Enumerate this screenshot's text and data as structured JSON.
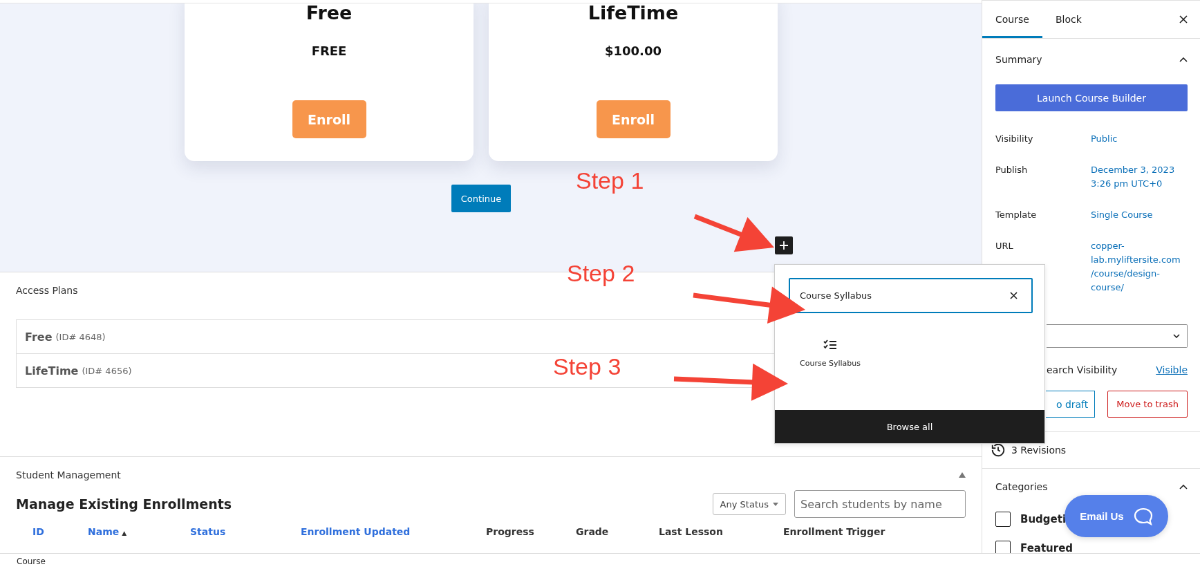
{
  "canvas": {
    "plans": [
      {
        "title": "Free",
        "price": "FREE",
        "button": "Enroll"
      },
      {
        "title": "LifeTime",
        "price": "$100.00",
        "button": "Enroll"
      }
    ],
    "continue_button": "Continue"
  },
  "annotations": [
    {
      "text": "Step 1"
    },
    {
      "text": "Step 2"
    },
    {
      "text": "Step 3"
    }
  ],
  "block_inserter": {
    "search_value": "Course Syllabus",
    "results": [
      {
        "label": "Course Syllabus"
      }
    ],
    "browse_all": "Browse all"
  },
  "access_plans": {
    "title": "Access Plans",
    "plans": [
      {
        "name": "Free",
        "id": "(ID# 4648)"
      },
      {
        "name": "LifeTime",
        "id": "(ID# 4656)"
      }
    ]
  },
  "student_management": {
    "title": "Student Management",
    "expanded": true,
    "heading": "Manage Existing Enrollments",
    "status_filter": "Any Status",
    "search": {
      "placeholder": "Search students by name"
    },
    "columns": [
      {
        "label": "ID",
        "sortable": true
      },
      {
        "label": "Name",
        "sortable": true,
        "sort_indicator": "▲"
      },
      {
        "label": "Status",
        "sortable": true
      },
      {
        "label": "Enrollment Updated",
        "sortable": true
      },
      {
        "label": "Progress",
        "sortable": false
      },
      {
        "label": "Grade",
        "sortable": false
      },
      {
        "label": "Last Lesson",
        "sortable": false
      },
      {
        "label": "Enrollment Trigger",
        "sortable": false
      }
    ]
  },
  "sidebar": {
    "tabs": [
      {
        "label": "Course",
        "selected": true
      },
      {
        "label": "Block",
        "selected": false
      }
    ],
    "summary": {
      "title": "Summary",
      "expanded": true,
      "launch_button": "Launch Course Builder",
      "rows": [
        {
          "label": "Visibility",
          "value": "Public"
        },
        {
          "label": "Publish",
          "value": "December 3, 2023\n3:26 pm UTC+0"
        },
        {
          "label": "Template",
          "value": "Single Course"
        },
        {
          "label": "URL",
          "value": "copper-\nlab.myliftersite.com\n/course/design-\ncourse/"
        }
      ],
      "search_visibility": {
        "label": "earch Visibility",
        "value": "Visible"
      },
      "draft_button": "o draft",
      "trash_button": "Move to trash"
    },
    "revisions": "3 Revisions",
    "categories": {
      "title": "Categories",
      "expanded": true,
      "items": [
        {
          "label": "Budgeti",
          "checked": false
        },
        {
          "label": "Featured",
          "checked": false
        }
      ]
    }
  },
  "email_us": "Email Us",
  "status_bar": "Course"
}
